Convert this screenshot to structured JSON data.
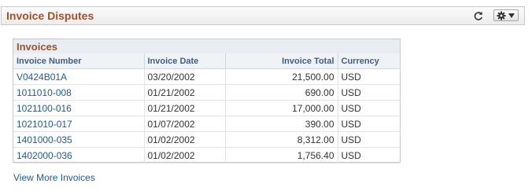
{
  "pagelet": {
    "title": "Invoice Disputes",
    "refresh_icon": "refresh-icon",
    "options_icon": "gear-icon"
  },
  "grid": {
    "title": "Invoices",
    "columns": [
      "Invoice Number",
      "Invoice Date",
      "Invoice Total",
      "Currency"
    ],
    "rows": [
      {
        "invoice_number": "V0424B01A",
        "invoice_date": "03/20/2002",
        "invoice_total": "21,500.00",
        "currency": "USD"
      },
      {
        "invoice_number": "1011010-008",
        "invoice_date": "01/21/2002",
        "invoice_total": "690.00",
        "currency": "USD"
      },
      {
        "invoice_number": "1021100-016",
        "invoice_date": "01/21/2002",
        "invoice_total": "17,000.00",
        "currency": "USD"
      },
      {
        "invoice_number": "1021010-017",
        "invoice_date": "01/07/2002",
        "invoice_total": "390.00",
        "currency": "USD"
      },
      {
        "invoice_number": "1401000-035",
        "invoice_date": "01/02/2002",
        "invoice_total": "8,312.00",
        "currency": "USD"
      },
      {
        "invoice_number": "1402000-036",
        "invoice_date": "01/02/2002",
        "invoice_total": "1,756.40",
        "currency": "USD"
      }
    ]
  },
  "footer": {
    "more_link": "View More Invoices"
  },
  "colors": {
    "title": "#a0522d",
    "link": "#1f5a98",
    "header_text": "#3f5f86"
  }
}
